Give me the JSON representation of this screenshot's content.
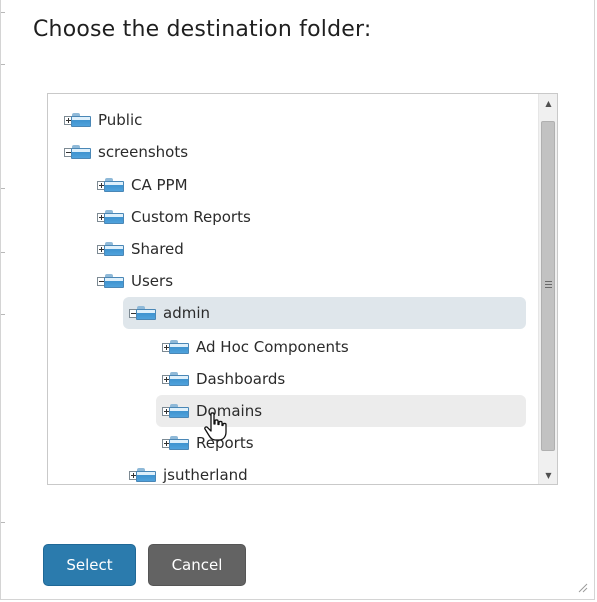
{
  "dialog": {
    "title": "Choose the destination folder:",
    "select_label": "Select",
    "cancel_label": "Cancel"
  },
  "tree": {
    "nodes": [
      {
        "label": "Public",
        "toggle": "plus"
      },
      {
        "label": "screenshots",
        "toggle": "minus"
      },
      {
        "label": "CA PPM",
        "toggle": "plus"
      },
      {
        "label": "Custom Reports",
        "toggle": "plus"
      },
      {
        "label": "Shared",
        "toggle": "plus"
      },
      {
        "label": "Users",
        "toggle": "minus"
      },
      {
        "label": "admin",
        "toggle": "minus",
        "state": "selected"
      },
      {
        "label": "Ad Hoc Components",
        "toggle": "plus"
      },
      {
        "label": "Dashboards",
        "toggle": "plus"
      },
      {
        "label": "Domains",
        "toggle": "plus",
        "state": "hover"
      },
      {
        "label": "Reports",
        "toggle": "plus"
      },
      {
        "label": "jsutherland",
        "toggle": "plus"
      }
    ]
  },
  "colors": {
    "select_button": "#2b7bad",
    "cancel_button": "#636363",
    "selected_row": "#dfe6eb",
    "hover_row": "#ececec"
  }
}
